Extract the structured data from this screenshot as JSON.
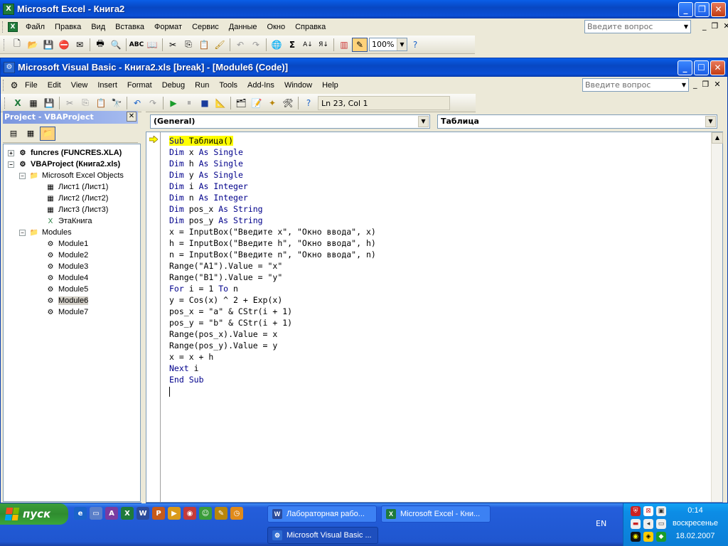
{
  "excel": {
    "title": "Microsoft Excel - Книга2",
    "menu": [
      "Файл",
      "Правка",
      "Вид",
      "Вставка",
      "Формат",
      "Сервис",
      "Данные",
      "Окно",
      "Справка"
    ],
    "ask_placeholder": "Введите вопрос",
    "zoom": "100%"
  },
  "vbe": {
    "title": "Microsoft Visual Basic - Книга2.xls [break] - [Module6 (Code)]",
    "menu": [
      "File",
      "Edit",
      "View",
      "Insert",
      "Format",
      "Debug",
      "Run",
      "Tools",
      "Add-Ins",
      "Window",
      "Help"
    ],
    "ask_placeholder": "Введите вопрос",
    "status": "Ln 23, Col 1",
    "project_title": "Project - VBAProject",
    "tree": [
      {
        "label": "funcres (FUNCRES.XLA)"
      },
      {
        "label": "VBAProject (Книга2.xls)"
      },
      {
        "label": "Microsoft Excel Objects"
      },
      {
        "label": "Лист1 (Лист1)"
      },
      {
        "label": "Лист2 (Лист2)"
      },
      {
        "label": "Лист3 (Лист3)"
      },
      {
        "label": "ЭтаКнига"
      },
      {
        "label": "Modules"
      },
      {
        "label": "Module1"
      },
      {
        "label": "Module2"
      },
      {
        "label": "Module3"
      },
      {
        "label": "Module4"
      },
      {
        "label": "Module5"
      },
      {
        "label": "Module6"
      },
      {
        "label": "Module7"
      }
    ],
    "object_combo": "(General)",
    "proc_combo": "Таблица",
    "code_lines": [
      "Sub Таблица()",
      "Dim x As Single",
      "Dim h As Single",
      "Dim y As Single",
      "Dim i As Integer",
      "Dim n As Integer",
      "Dim pos_x As String",
      "Dim pos_y As String",
      "x = InputBox(\"Введите x\", \"Окно ввода\", x)",
      "h = InputBox(\"Введите h\", \"Окно ввода\", h)",
      "n = InputBox(\"Введите n\", \"Окно ввода\", n)",
      "Range(\"A1\").Value = \"x\"",
      "Range(\"B1\").Value = \"y\"",
      "For i = 1 To n",
      "y = Cos(x) ^ 2 + Exp(x)",
      "pos_x = \"a\" & CStr(i + 1)",
      "pos_y = \"b\" & CStr(i + 1)",
      "Range(pos_x).Value = x",
      "Range(pos_y).Value = y",
      "x = x + h",
      "Next i",
      "End Sub",
      ""
    ]
  },
  "taskbar": {
    "start_label": "пуск",
    "tasks": [
      "Лабораторная рабо...",
      "Microsoft Excel - Кни...",
      "Microsoft Visual Basic ..."
    ],
    "language": "EN",
    "time": "0:14",
    "day": "воскресенье",
    "date": "18.02.2007"
  }
}
